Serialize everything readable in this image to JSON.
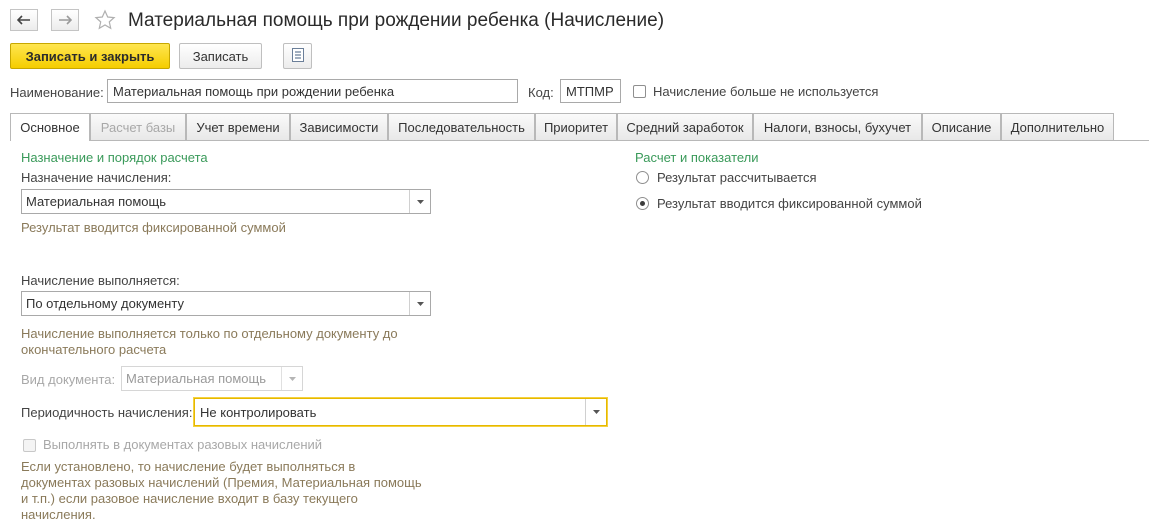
{
  "window": {
    "title": "Материальная помощь при рождении ребенка (Начисление)"
  },
  "toolbar": {
    "save_close_label": "Записать и закрыть",
    "save_label": "Записать"
  },
  "header_fields": {
    "name_label": "Наименование:",
    "name_value": "Материальная помощь при рождении ребенка",
    "code_label": "Код:",
    "code_value": "МТПМР",
    "unused_label": "Начисление больше не используется",
    "unused_checked": false
  },
  "tabs": [
    {
      "label": "Основное",
      "state": "active"
    },
    {
      "label": "Расчет базы",
      "state": "disabled"
    },
    {
      "label": "Учет времени",
      "state": "normal"
    },
    {
      "label": "Зависимости",
      "state": "normal"
    },
    {
      "label": "Последовательность",
      "state": "normal"
    },
    {
      "label": "Приоритет",
      "state": "normal"
    },
    {
      "label": "Средний заработок",
      "state": "normal"
    },
    {
      "label": "Налоги, взносы, бухучет",
      "state": "normal"
    },
    {
      "label": "Описание",
      "state": "normal"
    },
    {
      "label": "Дополнительно",
      "state": "normal"
    }
  ],
  "left": {
    "section_title": "Назначение и порядок расчета",
    "purpose_label": "Назначение начисления:",
    "purpose_value": "Материальная помощь",
    "purpose_hint": "Результат вводится фиксированной суммой",
    "execution_label": "Начисление выполняется:",
    "execution_value": "По отдельному документу",
    "execution_hint_1": "Начисление выполняется только по отдельному документу до",
    "execution_hint_2": "окончательного расчета",
    "doc_type_label": "Вид документа:",
    "doc_type_value": "Материальная помощь",
    "periodicity_label": "Периодичность начисления:",
    "periodicity_value": "Не контролировать",
    "onetime_label": "Выполнять в документах разовых начислений",
    "onetime_hint_1": "Если установлено, то начисление будет выполняться в",
    "onetime_hint_2": "документах разовых начислений (Премия, Материальная помощь",
    "onetime_hint_3": "и т.п.) если разовое начисление входит в базу текущего",
    "onetime_hint_4": "начисления."
  },
  "right": {
    "section_title": "Расчет и показатели",
    "option_calculated": "Результат рассчитывается",
    "option_fixed": "Результат вводится фиксированной суммой",
    "selected": "fixed"
  },
  "colors": {
    "primary_button": "#f5cd00",
    "section_title": "#3a9a5a",
    "hint_text": "#8a7a5a",
    "focus_border": "#e6b800"
  }
}
